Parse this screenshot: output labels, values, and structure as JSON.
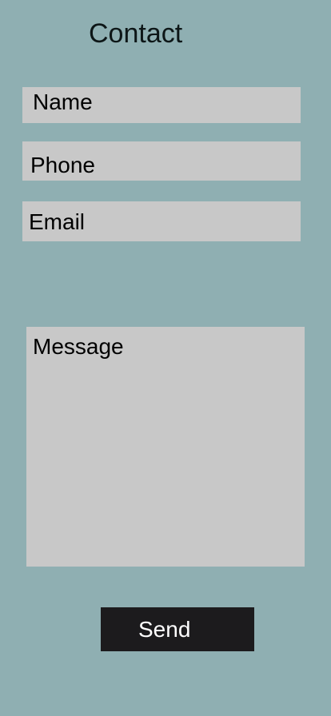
{
  "header": {
    "title": "Contact"
  },
  "form": {
    "name_placeholder": "Name",
    "phone_placeholder": "Phone",
    "email_placeholder": "Email",
    "message_placeholder": "Message",
    "send_label": "Send"
  },
  "colors": {
    "background": "#8fafb2",
    "field_background": "#c8c8c8",
    "button_background": "#1c1b1d",
    "button_text": "#ffffff"
  }
}
